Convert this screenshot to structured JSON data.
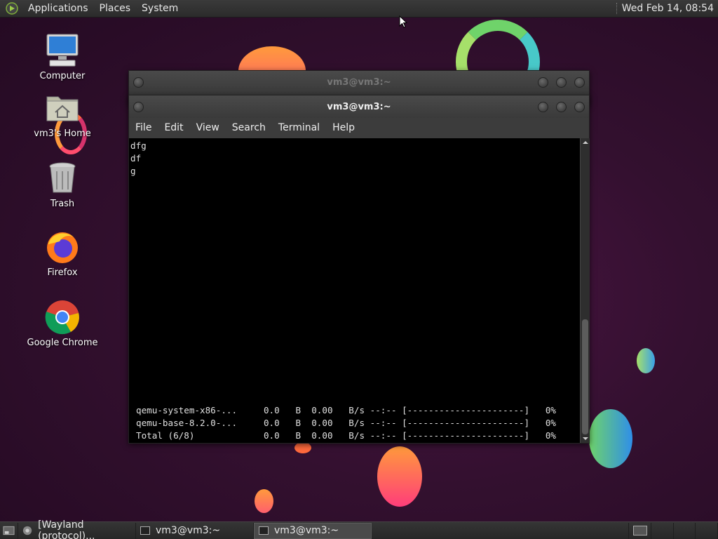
{
  "top_panel": {
    "menus": [
      "Applications",
      "Places",
      "System"
    ],
    "clock": "Wed Feb 14, 08:54"
  },
  "desktop_icons": [
    {
      "label": "Computer",
      "icon": "computer-icon"
    },
    {
      "label": "vm3's Home",
      "icon": "home-folder-icon"
    },
    {
      "label": "Trash",
      "icon": "trash-icon"
    },
    {
      "label": "Firefox",
      "icon": "firefox-icon"
    },
    {
      "label": "Google Chrome",
      "icon": "chrome-icon"
    }
  ],
  "back_window": {
    "title": "vm3@vm3:~"
  },
  "terminal": {
    "title": "vm3@vm3:~",
    "menu": [
      "File",
      "Edit",
      "View",
      "Search",
      "Terminal",
      "Help"
    ],
    "lines": [
      "dfg",
      "df",
      "g"
    ],
    "progress_lines": [
      "qemu-system-x86-...     0.0   B  0.00   B/s --:-- [----------------------]   0%",
      "qemu-base-8.2.0-...     0.0   B  0.00   B/s --:-- [----------------------]   0%",
      "Total (6/8)             0.0   B  0.00   B/s --:-- [----------------------]   0%"
    ]
  },
  "taskbar": {
    "tasks": [
      {
        "label": "[Wayland (protocol)...",
        "icon": "chrome-icon"
      },
      {
        "label": "vm3@vm3:~",
        "icon": "terminal-icon"
      },
      {
        "label": "vm3@vm3:~",
        "icon": "terminal-icon",
        "active": true
      }
    ]
  },
  "colors": {
    "panel": "#2f2f2f",
    "terminal_bg": "#000000",
    "desktop": "#2e0e2b"
  }
}
